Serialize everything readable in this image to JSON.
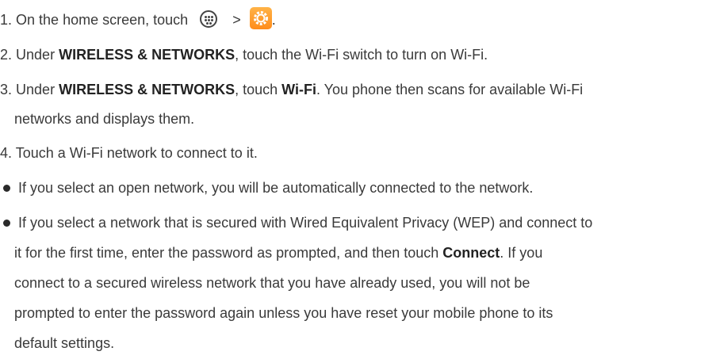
{
  "steps": [
    {
      "num": "1.",
      "pre": "On the home screen, touch",
      "sep": ">",
      "post": "."
    },
    {
      "num": "2.",
      "pre": "Under",
      "bold1": "WIRELESS & NETWORKS",
      "post": ", touch the Wi-Fi switch to turn on Wi-Fi."
    },
    {
      "num": "3.",
      "pre": "Under",
      "bold1": "WIRELESS & NETWORKS",
      "mid": ", touch",
      "bold2": "Wi-Fi",
      "post": ". You phone then scans for available Wi-Fi",
      "cont": "networks and displays them."
    },
    {
      "num": "4.",
      "pre": "Touch a Wi-Fi network to connect to it."
    }
  ],
  "bullets": [
    {
      "text": "If you select an open network, you will be automatically connected to the network."
    },
    {
      "line1": "If you select a network that is secured with Wired Equivalent Privacy (WEP) and connect to",
      "line2_pre": "it for the first time, enter the password as prompted, and then touch",
      "line2_bold": "Connect",
      "line2_post": ". If you",
      "line3": "connect to a secured wireless network that you have already used, you will not be",
      "line4": "prompted to enter the password again unless you have reset your mobile phone to its",
      "line5": "default settings."
    }
  ],
  "icons": {
    "apps": "apps-grid-icon",
    "settings": "settings-gear-icon",
    "settings_color": "#ff9a2e"
  }
}
